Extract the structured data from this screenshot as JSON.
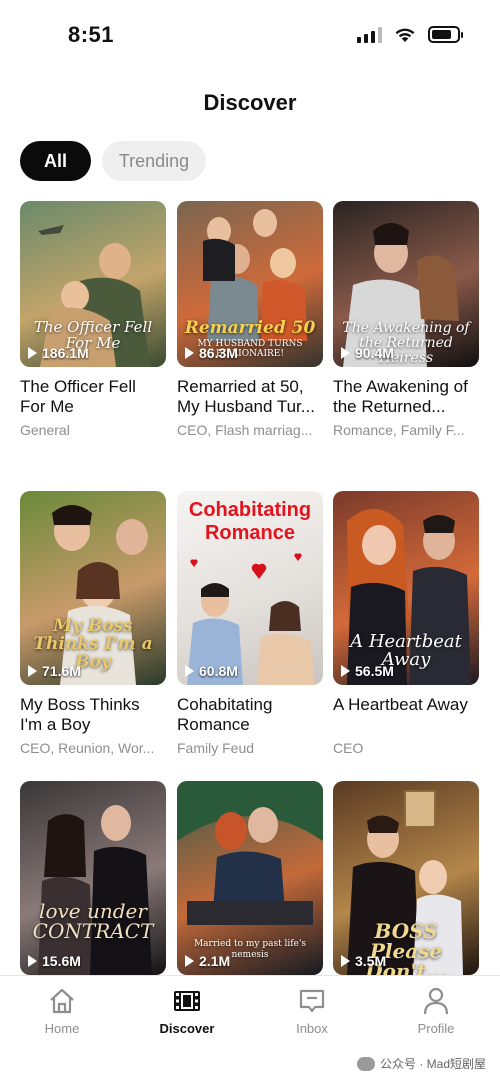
{
  "status_bar": {
    "time": "8:51"
  },
  "header": {
    "title": "Discover"
  },
  "filters": [
    {
      "label": "All",
      "selected": true
    },
    {
      "label": "Trending",
      "selected": false
    }
  ],
  "dramas": [
    {
      "title": "The Officer Fell For Me",
      "tags": "General",
      "views": "186.1M",
      "poster_text": "The Officer Fell For Me",
      "palette": [
        "#6a8a6a",
        "#c2a46a",
        "#3a4a32"
      ]
    },
    {
      "title": "Remarried at 50, My Husband Tur...",
      "tags": "CEO, Flash marriag...",
      "views": "86.3M",
      "poster_text": "Remarried 50",
      "poster_subtext": "MY HUSBAND TURNS BILLIONAIRE!",
      "palette": [
        "#7a6650",
        "#cf6a3a",
        "#33322e"
      ]
    },
    {
      "title": "The Awakening of the Returned...",
      "tags": "Romance, Family F...",
      "views": "90.4M",
      "poster_text": "The Awakening of the Returned Heiress",
      "palette": [
        "#2a2422",
        "#8a5a4a",
        "#111010"
      ]
    },
    {
      "title": "My Boss Thinks I'm a Boy",
      "tags": "CEO, Reunion, Wor...",
      "views": "71.6M",
      "poster_text": "My Boss Thinks I'm a Boy",
      "palette": [
        "#6a8a3a",
        "#c89a6a",
        "#2a3a2a"
      ]
    },
    {
      "title": "Cohabitating Romance",
      "tags": "Family Feud",
      "views": "60.8M",
      "poster_text": "Cohabitating Romance",
      "palette": [
        "#f6f4f2",
        "#e4e0dc",
        "#c9c4c0"
      ]
    },
    {
      "title": "A Heartbeat Away",
      "tags": "CEO",
      "views": "56.5M",
      "poster_text": "A Heartbeat Away",
      "palette": [
        "#7a3a2a",
        "#d46a3a",
        "#1e1a22"
      ]
    },
    {
      "title": "",
      "tags": "",
      "views": "15.6M",
      "poster_text": "love under CONTRACT",
      "palette": [
        "#3a3638",
        "#8a7a78",
        "#141214"
      ]
    },
    {
      "title": "",
      "tags": "",
      "views": "2.1M",
      "poster_text": "Married to my past life's nemesis",
      "palette": [
        "#3a5a4a",
        "#c46a3a",
        "#141a22"
      ]
    },
    {
      "title": "",
      "tags": "",
      "views": "3.5M",
      "poster_text": "BOSS Please Don't...",
      "palette": [
        "#5a3a22",
        "#b4864a",
        "#1e1410"
      ]
    }
  ],
  "tab_bar": [
    {
      "label": "Home",
      "icon": "home-icon",
      "active": false
    },
    {
      "label": "Discover",
      "icon": "film-icon",
      "active": true
    },
    {
      "label": "Inbox",
      "icon": "inbox-icon",
      "active": false
    },
    {
      "label": "Profile",
      "icon": "profile-icon",
      "active": false
    }
  ],
  "watermark": "公众号 · Mad短剧屋",
  "battery_level": 0.8
}
